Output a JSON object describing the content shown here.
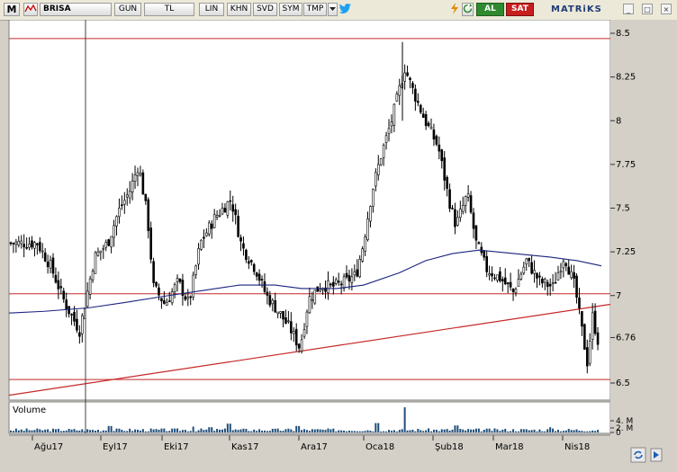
{
  "toolbar": {
    "logo_letter": "M",
    "symbol": "BRISA",
    "buttons": [
      "GUN",
      "TL",
      "LIN",
      "KHN",
      "SVD",
      "SYM",
      "TMP"
    ],
    "buy_label": "AL",
    "sell_label": "SAT",
    "brand": "MATRiKS",
    "window_buttons": [
      "_",
      "□",
      "×"
    ]
  },
  "colors": {
    "background": "#ffffff",
    "candle": "#000000",
    "moving_average": "#1a237e",
    "support_resistance": "#c62828",
    "volume": "#1f4e79",
    "accent_green": "#2f8a2f",
    "accent_red": "#c81e1e"
  },
  "chart_data": {
    "type": "candlestick",
    "symbol": "BRISA",
    "y_ticks": [
      "8.5",
      "8.25",
      "8",
      "7.75",
      "7.5",
      "7.25",
      "7",
      "6.76",
      "6.5"
    ],
    "y_tick_values": [
      8.5,
      8.25,
      8.0,
      7.75,
      7.5,
      7.25,
      7.0,
      6.76,
      6.5
    ],
    "ylim": [
      6.42,
      8.54
    ],
    "x_ticks": [
      "Ağu17",
      "Eyl17",
      "Eki17",
      "Kas17",
      "Ara17",
      "Oca18",
      "Şub18",
      "Mar18",
      "Nis18"
    ],
    "horizontal_lines": [
      8.47,
      7.01,
      6.52
    ],
    "trendline": {
      "from": [
        "Jul17",
        6.43
      ],
      "to": [
        "Apr18",
        6.95
      ]
    },
    "moving_average": [
      [
        0,
        6.9
      ],
      [
        40,
        6.91
      ],
      [
        90,
        6.93
      ],
      [
        130,
        6.96
      ],
      [
        180,
        7.0
      ],
      [
        220,
        7.03
      ],
      [
        260,
        7.06
      ],
      [
        300,
        7.06
      ],
      [
        330,
        7.04
      ],
      [
        370,
        7.04
      ],
      [
        400,
        7.06
      ],
      [
        440,
        7.13
      ],
      [
        470,
        7.2
      ],
      [
        500,
        7.24
      ],
      [
        530,
        7.26
      ],
      [
        570,
        7.24
      ],
      [
        610,
        7.22
      ],
      [
        640,
        7.2
      ],
      [
        668,
        7.17
      ]
    ],
    "close_series": [
      [
        0,
        7.3
      ],
      [
        30,
        7.3
      ],
      [
        45,
        7.17
      ],
      [
        62,
        6.95
      ],
      [
        78,
        6.8
      ],
      [
        95,
        7.22
      ],
      [
        110,
        7.3
      ],
      [
        122,
        7.48
      ],
      [
        135,
        7.6
      ],
      [
        145,
        7.75
      ],
      [
        155,
        7.45
      ],
      [
        162,
        7.05
      ],
      [
        175,
        6.95
      ],
      [
        190,
        7.08
      ],
      [
        202,
        6.95
      ],
      [
        215,
        7.3
      ],
      [
        232,
        7.45
      ],
      [
        250,
        7.55
      ],
      [
        262,
        7.28
      ],
      [
        278,
        7.15
      ],
      [
        290,
        7.0
      ],
      [
        305,
        6.9
      ],
      [
        318,
        6.8
      ],
      [
        328,
        6.7
      ],
      [
        338,
        6.98
      ],
      [
        352,
        7.06
      ],
      [
        365,
        7.05
      ],
      [
        380,
        7.08
      ],
      [
        392,
        7.12
      ],
      [
        400,
        7.3
      ],
      [
        410,
        7.6
      ],
      [
        420,
        7.8
      ],
      [
        432,
        8.0
      ],
      [
        447,
        8.3
      ],
      [
        458,
        8.15
      ],
      [
        470,
        8.0
      ],
      [
        485,
        7.85
      ],
      [
        497,
        7.55
      ],
      [
        505,
        7.4
      ],
      [
        518,
        7.58
      ],
      [
        528,
        7.3
      ],
      [
        540,
        7.15
      ],
      [
        555,
        7.1
      ],
      [
        570,
        7.02
      ],
      [
        585,
        7.2
      ],
      [
        600,
        7.08
      ],
      [
        615,
        7.05
      ],
      [
        628,
        7.23
      ],
      [
        640,
        7.05
      ],
      [
        648,
        6.8
      ],
      [
        654,
        6.62
      ],
      [
        660,
        6.88
      ],
      [
        668,
        6.7
      ]
    ],
    "volume_axis": [
      "4. M",
      "2. M",
      "0"
    ],
    "volume_label": "Volume",
    "volume_spikes": [
      [
        447,
        4.3
      ],
      [
        112,
        1.1
      ],
      [
        207,
        1.0
      ],
      [
        226,
        0.9
      ],
      [
        247,
        1.5
      ],
      [
        325,
        1.1
      ],
      [
        416,
        1.6
      ],
      [
        505,
        1.2
      ],
      [
        612,
        0.9
      ]
    ]
  }
}
